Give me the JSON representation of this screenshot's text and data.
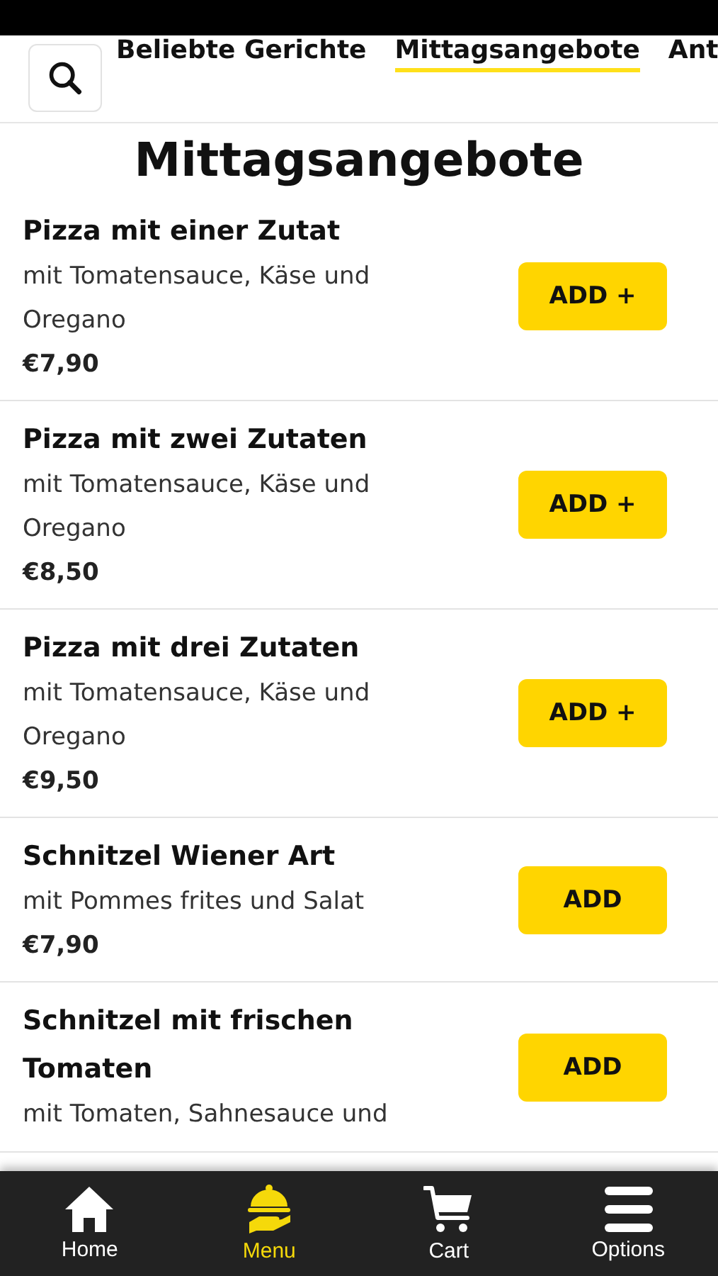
{
  "tabs": [
    {
      "label": "Beliebte Gerichte",
      "selected": false
    },
    {
      "label": "Mittagsangebote",
      "selected": true
    },
    {
      "label": "Ant",
      "selected": false
    }
  ],
  "section_title": "Mittagsangebote",
  "items": [
    {
      "name": "Pizza mit einer Zutat",
      "description": "mit Tomatensauce, Käse und Oregano",
      "price": "€7,90",
      "button": "ADD +"
    },
    {
      "name": "Pizza mit zwei Zutaten",
      "description": "mit Tomatensauce, Käse und Oregano",
      "price": "€8,50",
      "button": "ADD +"
    },
    {
      "name": "Pizza mit drei Zutaten",
      "description": "mit Tomatensauce, Käse und Oregano",
      "price": "€9,50",
      "button": "ADD +"
    },
    {
      "name": "Schnitzel Wiener Art",
      "description": "mit Pommes frites und Salat",
      "price": "€7,90",
      "button": "ADD"
    },
    {
      "name": "Schnitzel mit frischen Tomaten",
      "description": "mit Tomaten, Sahnesauce und",
      "button": "ADD"
    }
  ],
  "nav": [
    {
      "label": "Home",
      "kind": "home",
      "selected": false
    },
    {
      "label": "Menu",
      "kind": "food",
      "selected": true
    },
    {
      "label": "Cart",
      "kind": "cart",
      "selected": false
    },
    {
      "label": "Options",
      "kind": "more",
      "selected": false
    }
  ]
}
